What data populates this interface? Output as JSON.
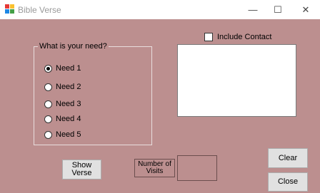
{
  "window": {
    "title": "Bible Verse",
    "minimize_glyph": "—",
    "maximize_glyph": "☐",
    "close_glyph": "✕"
  },
  "need_group": {
    "label": "What is your need?",
    "options": [
      {
        "label": "Need 1",
        "checked": true
      },
      {
        "label": "Need 2",
        "checked": false
      },
      {
        "label": "Need 3",
        "checked": false
      },
      {
        "label": "Need 4",
        "checked": false
      },
      {
        "label": "Need 5",
        "checked": false
      }
    ]
  },
  "include_contact": {
    "label": "Include Contact",
    "checked": false
  },
  "verse_text": "",
  "buttons": {
    "show_verse_line1": "Show",
    "show_verse_line2": "Verse",
    "clear": "Clear",
    "close": "Close"
  },
  "visits": {
    "label_line1": "Number of",
    "label_line2": "Visits",
    "value": ""
  },
  "colors": {
    "form_background": "#bc8f8f"
  }
}
